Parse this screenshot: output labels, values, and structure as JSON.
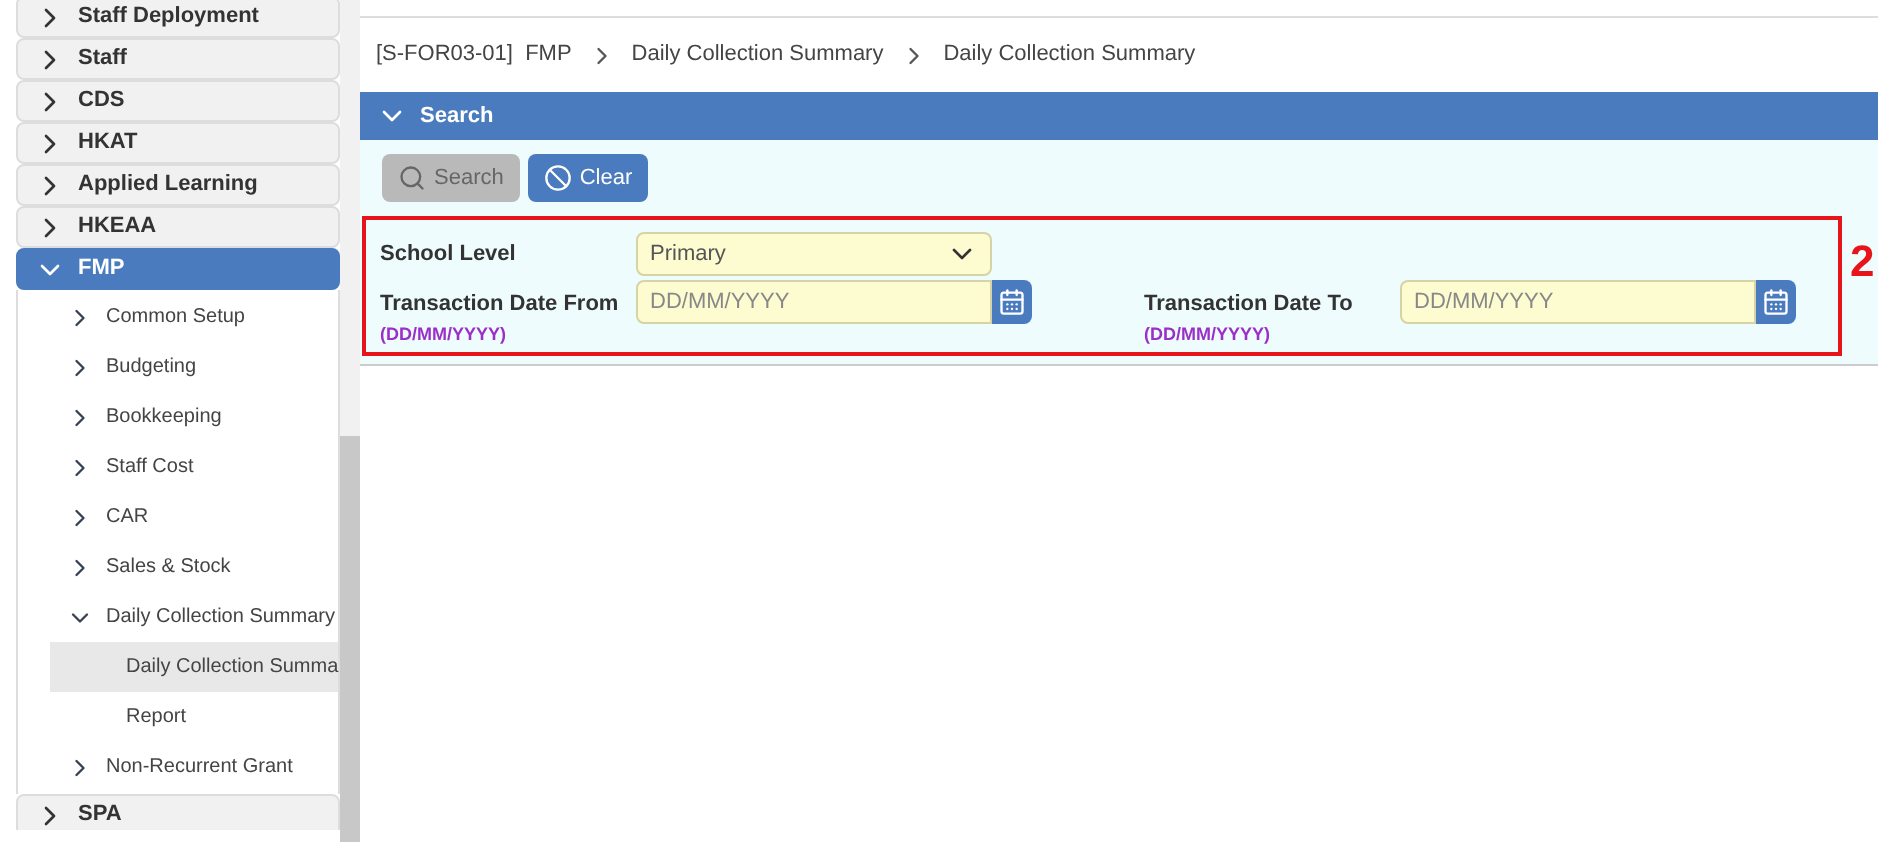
{
  "sidebar": {
    "items": [
      {
        "label": "Staff Deployment",
        "expanded": false
      },
      {
        "label": "Staff",
        "expanded": false
      },
      {
        "label": "CDS",
        "expanded": false
      },
      {
        "label": "HKAT",
        "expanded": false
      },
      {
        "label": "Applied Learning",
        "expanded": false
      },
      {
        "label": "HKEAA",
        "expanded": false
      },
      {
        "label": "FMP",
        "expanded": true,
        "children": [
          {
            "label": "Common Setup",
            "expanded": false
          },
          {
            "label": "Budgeting",
            "expanded": false
          },
          {
            "label": "Bookkeeping",
            "expanded": false
          },
          {
            "label": "Staff Cost",
            "expanded": false
          },
          {
            "label": "CAR",
            "expanded": false
          },
          {
            "label": "Sales & Stock",
            "expanded": false
          },
          {
            "label": "Daily Collection Summary",
            "expanded": true,
            "children": [
              {
                "label": "Daily Collection Summa",
                "selected": true
              },
              {
                "label": "Report",
                "selected": false
              }
            ]
          },
          {
            "label": "Non-Recurrent Grant",
            "expanded": false
          }
        ]
      },
      {
        "label": "SPA",
        "expanded": false
      }
    ]
  },
  "breadcrumb": [
    "[S-FOR03-01]  FMP",
    "Daily Collection Summary",
    "Daily Collection Summary"
  ],
  "search_panel": {
    "title": "Search",
    "expanded": true,
    "buttons": [
      {
        "label": "Search",
        "kind": "search",
        "disabled": true
      },
      {
        "label": "Clear",
        "kind": "clear",
        "disabled": false
      }
    ],
    "school_level": {
      "label": "School Level",
      "value": "Primary"
    },
    "date_from": {
      "label": "Transaction Date From",
      "hint": "(DD/MM/YYYY)",
      "placeholder": "DD/MM/YYYY"
    },
    "date_to": {
      "label": "Transaction Date To",
      "hint": "(DD/MM/YYYY)",
      "placeholder": "DD/MM/YYYY"
    },
    "annotation": "2"
  }
}
